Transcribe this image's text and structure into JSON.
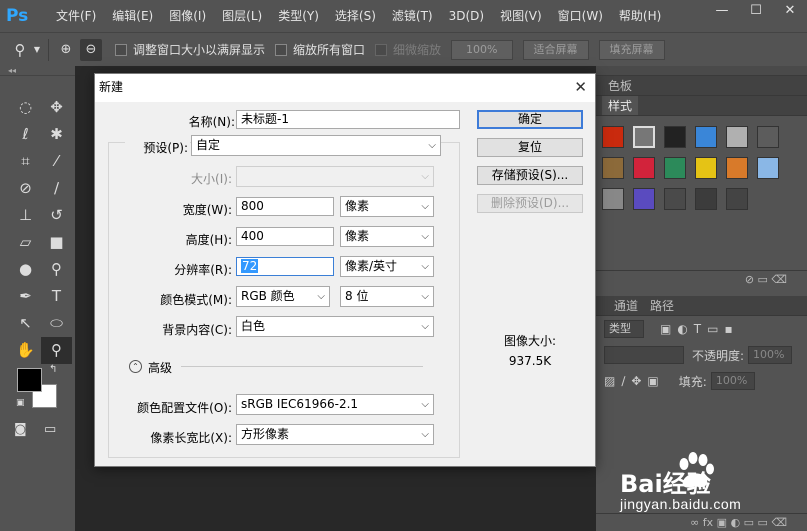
{
  "app": {
    "logo": "Ps"
  },
  "menu": [
    "文件(F)",
    "编辑(E)",
    "图像(I)",
    "图层(L)",
    "类型(Y)",
    "选择(S)",
    "滤镜(T)",
    "3D(D)",
    "视图(V)",
    "窗口(W)",
    "帮助(H)"
  ],
  "options": {
    "resize_windows": "调整窗口大小以满屏显示",
    "zoom_all": "缩放所有窗口",
    "scrubby_zoom": "细微缩放",
    "zoom_100": "100%",
    "fit_screen": "适合屏幕",
    "fill_screen": "填充屏幕"
  },
  "panels": {
    "tab_color": "色板",
    "tab_styles": "样式",
    "tab_channels": "通道",
    "tab_paths": "路径",
    "kind_label": "类型",
    "opacity_label": "不透明度:",
    "opacity_value": "100%",
    "fill_label": "填充:",
    "fill_value": "100%"
  },
  "dialog": {
    "title": "新建",
    "name_label": "名称(N):",
    "name_value": "未标题-1",
    "preset_label": "预设(P):",
    "preset_value": "自定",
    "size_label": "大小(I):",
    "width_label": "宽度(W):",
    "width_value": "800",
    "width_unit": "像素",
    "height_label": "高度(H):",
    "height_value": "400",
    "height_unit": "像素",
    "resolution_label": "分辨率(R):",
    "resolution_value": "72",
    "resolution_unit": "像素/英寸",
    "color_mode_label": "颜色模式(M):",
    "color_mode_value": "RGB 颜色",
    "bit_depth_value": "8 位",
    "background_label": "背景内容(C):",
    "background_value": "白色",
    "advanced_label": "高级",
    "color_profile_label": "颜色配置文件(O):",
    "color_profile_value": "sRGB IEC61966-2.1",
    "pixel_aspect_label": "像素长宽比(X):",
    "pixel_aspect_value": "方形像素",
    "ok_button": "确定",
    "reset_button": "复位",
    "save_preset_button": "存储预设(S)...",
    "delete_preset_button": "删除预设(D)...",
    "image_size_label": "图像大小:",
    "image_size_value": "937.5K"
  },
  "watermark": {
    "brand": "Bai经验",
    "url": "jingyan.baidu.com"
  }
}
